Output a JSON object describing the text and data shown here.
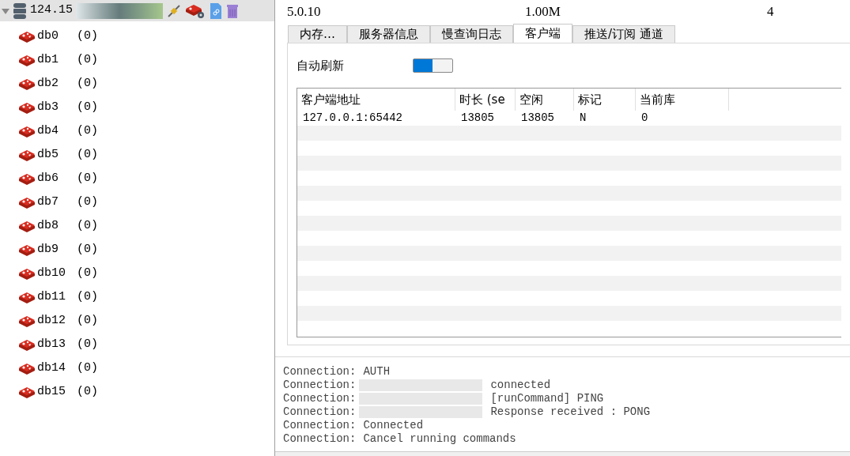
{
  "tree": {
    "host": "124.15",
    "expanded": true,
    "databases": [
      {
        "name": "db0",
        "count": "(0)"
      },
      {
        "name": "db1",
        "count": "(0)"
      },
      {
        "name": "db2",
        "count": "(0)"
      },
      {
        "name": "db3",
        "count": "(0)"
      },
      {
        "name": "db4",
        "count": "(0)"
      },
      {
        "name": "db5",
        "count": "(0)"
      },
      {
        "name": "db6",
        "count": "(0)"
      },
      {
        "name": "db7",
        "count": "(0)"
      },
      {
        "name": "db8",
        "count": "(0)"
      },
      {
        "name": "db9",
        "count": "(0)"
      },
      {
        "name": "db10",
        "count": "(0)"
      },
      {
        "name": "db11",
        "count": "(0)"
      },
      {
        "name": "db12",
        "count": "(0)"
      },
      {
        "name": "db13",
        "count": "(0)"
      },
      {
        "name": "db14",
        "count": "(0)"
      },
      {
        "name": "db15",
        "count": "(0)"
      }
    ]
  },
  "info_row": [
    "5.0.10",
    "1.00M",
    "4"
  ],
  "tabs": [
    {
      "label": "内存…",
      "selected": false
    },
    {
      "label": "服务器信息",
      "selected": false
    },
    {
      "label": "慢查询日志",
      "selected": false
    },
    {
      "label": "客户端",
      "selected": true
    },
    {
      "label": "推送/订阅 通道",
      "selected": false
    }
  ],
  "auto_refresh": {
    "label": "自动刷新",
    "on": true
  },
  "table": {
    "columns": [
      "客户端地址",
      "时长 (se",
      "空闲",
      "标记",
      "当前库"
    ],
    "rows": [
      [
        "127.0.0.1:65442",
        "13805",
        "13805",
        "N",
        "0"
      ]
    ]
  },
  "log": [
    {
      "prefix": "Connection:",
      "message": "AUTH",
      "redacted": false
    },
    {
      "prefix": "Connection:",
      "message": "connected",
      "redacted": true
    },
    {
      "prefix": "Connection:",
      "message": "[runCommand] PING",
      "redacted": true
    },
    {
      "prefix": "Connection:",
      "message": "Response received : PONG",
      "redacted": true
    },
    {
      "prefix": "Connection:",
      "message": "Connected",
      "redacted": false
    },
    {
      "prefix": "Connection:",
      "message": "Cancel running commands",
      "redacted": false
    }
  ]
}
